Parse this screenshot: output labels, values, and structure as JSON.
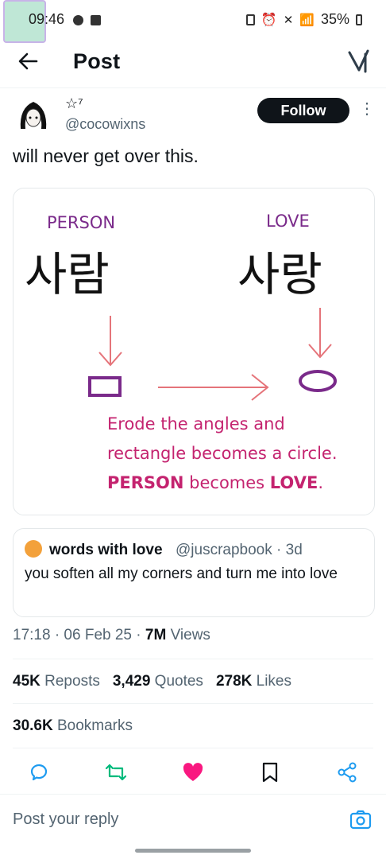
{
  "status_bar": {
    "time": "09:46",
    "battery": "35%"
  },
  "header": {
    "title": "Post"
  },
  "tweet": {
    "author_name": "☆⁷",
    "author_handle": "@cocowixns",
    "follow_label": "Follow",
    "text": "will never get over this.",
    "image": {
      "label_left": "PERSON",
      "label_right": "LOVE",
      "korean_left": "사람",
      "korean_right": "사랑",
      "caption_line1": "Erode the angles and",
      "caption_line2": "rectangle becomes a circle.",
      "caption_line3_a": "PERSON",
      "caption_line3_b": " becomes ",
      "caption_line3_c": "LOVE",
      "caption_line3_d": "."
    },
    "quote": {
      "name": "words with love",
      "handle": "@juscrapbook · 3d",
      "text": "you soften all my corners and turn me into love"
    },
    "meta": {
      "time": "17:18 · 06 Feb 25 · ",
      "views_count": "7M",
      "views_label": " Views"
    },
    "stats": {
      "reposts_count": "45K",
      "reposts_label": "Reposts",
      "quotes_count": "3,429",
      "quotes_label": "Quotes",
      "likes_count": "278K",
      "likes_label": "Likes",
      "bookmarks_count": "30.6K",
      "bookmarks_label": "Bookmarks"
    }
  },
  "reply": {
    "placeholder": "Post your reply"
  },
  "colors": {
    "like": "#f91880",
    "repost": "#00ba7c",
    "accent": "#1d9bf0",
    "image_pink": "#c4236f",
    "image_purple": "#7a2a8a",
    "image_arrow": "#e5747a"
  }
}
